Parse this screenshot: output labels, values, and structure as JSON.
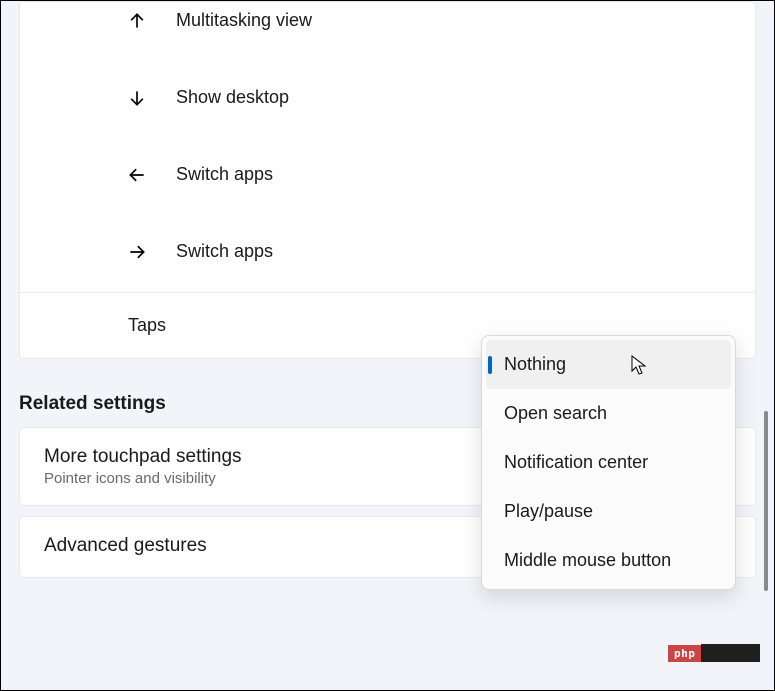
{
  "gestures": [
    {
      "icon": "arrow-up",
      "label": "Multitasking view"
    },
    {
      "icon": "arrow-down",
      "label": "Show desktop"
    },
    {
      "icon": "arrow-left",
      "label": "Switch apps"
    },
    {
      "icon": "arrow-right",
      "label": "Switch apps"
    }
  ],
  "taps": {
    "label": "Taps"
  },
  "dropdown": {
    "options": [
      "Nothing",
      "Open search",
      "Notification center",
      "Play/pause",
      "Middle mouse button"
    ],
    "selected_index": 0
  },
  "related": {
    "heading": "Related settings",
    "items": [
      {
        "title": "More touchpad settings",
        "subtitle": "Pointer icons and visibility"
      },
      {
        "title": "Advanced gestures",
        "subtitle": ""
      }
    ]
  },
  "watermark": {
    "left": "php",
    "right": ""
  }
}
